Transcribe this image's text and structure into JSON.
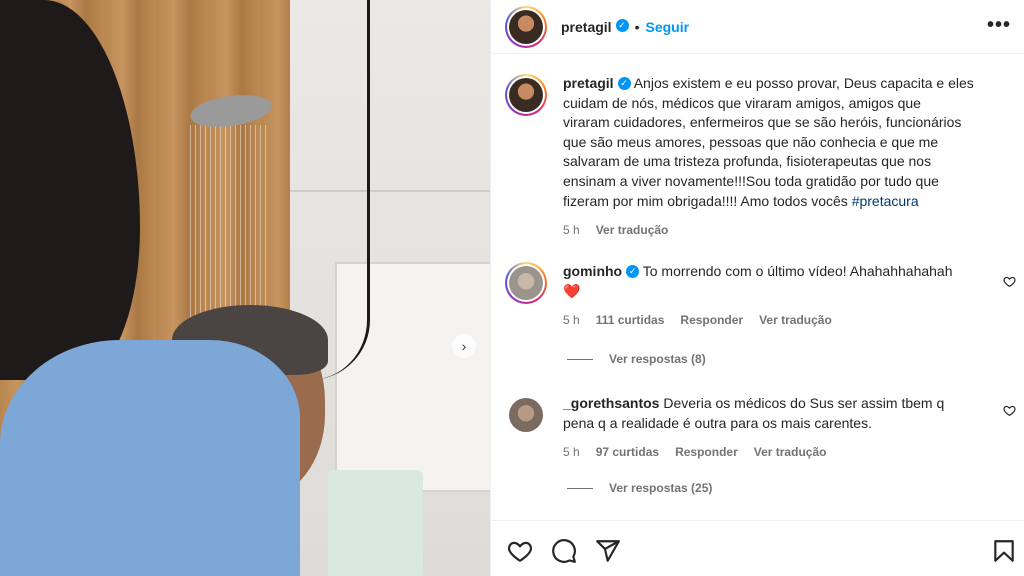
{
  "post": {
    "username": "pretagil",
    "follow_label": "Seguir",
    "separator": "•",
    "more_icon": "more-horizontal-icon",
    "media_nav_icon": "chevron-right-icon"
  },
  "caption": {
    "username": "pretagil",
    "lines": [
      "Anjos existem e eu posso provar, Deus capacita e eles",
      "cuidam de nós, médicos que viraram amigos, amigos que",
      "viraram cuidadores, enfermeiros que se são heróis, funcionários",
      "que são meus amores, pessoas que não conhecia e que me",
      "salvaram de uma tristeza profunda, fisioterapeutas que nos",
      "ensinam a viver novamente!!!Sou toda gratidão por tudo que"
    ],
    "last_line": "fizeram por mim obrigada!!!! Amo todos vocês ",
    "hashtag": "#pretacura",
    "time": "5 h",
    "translate": "Ver tradução"
  },
  "comments": [
    {
      "username": "gominho",
      "verified": true,
      "text": "To morrendo com o último vídeo! Ahahahhahahah",
      "emoji": "❤️",
      "time": "5 h",
      "likes": "111 curtidas",
      "reply": "Responder",
      "translate": "Ver tradução",
      "view_replies": "Ver respostas (8)"
    },
    {
      "username": "_gorethsantos",
      "verified": false,
      "text_line1": "Deveria os médicos do Sus ser assim tbem q",
      "text_line2": "pena q a realidade é outra para os mais carentes.",
      "time": "5 h",
      "likes": "97 curtidas",
      "reply": "Responder",
      "translate": "Ver tradução",
      "view_replies": "Ver respostas (25)"
    }
  ],
  "actions": [
    "heart-icon",
    "comment-icon",
    "share-icon",
    "bookmark-icon"
  ],
  "colors": {
    "link": "#0095f6",
    "hashtag": "#00376b",
    "secondary": "#737373",
    "emoji_heart": "#ed4956"
  }
}
